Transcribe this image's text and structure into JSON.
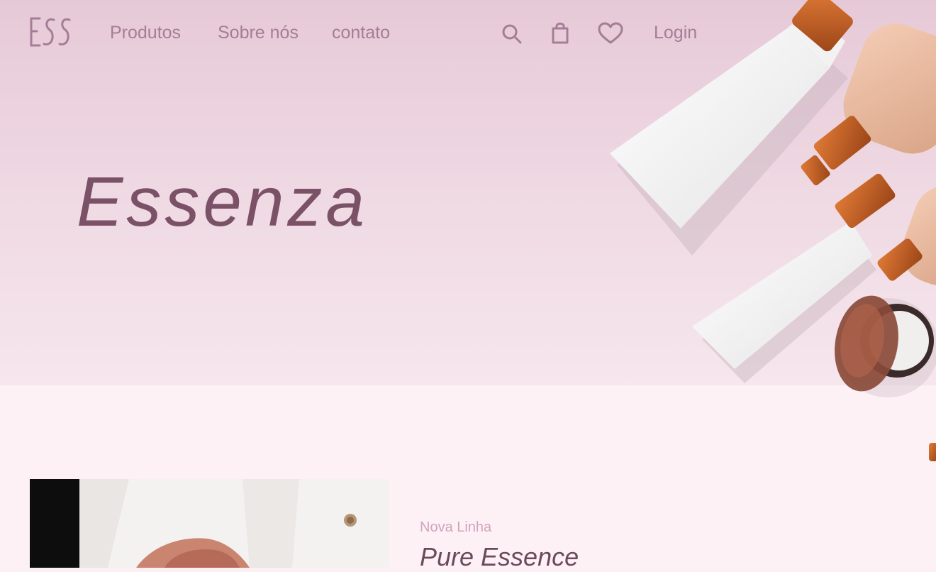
{
  "header": {
    "logo_text": "ESS",
    "nav": [
      {
        "label": "Produtos"
      },
      {
        "label": "Sobre nós"
      },
      {
        "label": "contato"
      }
    ],
    "icons": [
      "search-icon",
      "shopping-bag-icon",
      "heart-icon"
    ],
    "login_label": "Login"
  },
  "hero": {
    "title": "Essenza"
  },
  "feature": {
    "eyebrow": "Nova Linha",
    "title": "Pure Essence"
  },
  "colors": {
    "accent": "#a47e96",
    "title": "#7a5166",
    "copper": "#c8652a"
  }
}
